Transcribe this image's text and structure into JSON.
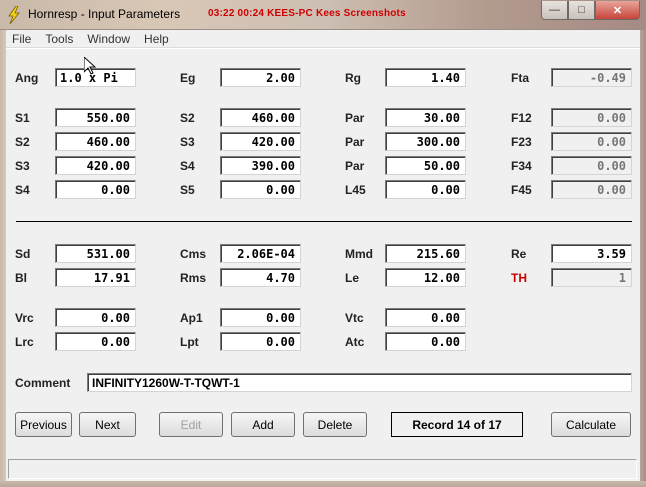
{
  "window": {
    "title": "Hornresp - Input Parameters",
    "recording_overlay": "03:22 00:24 KEES-PC Kees Screenshots",
    "minimize_glyph": "—",
    "maximize_glyph": "□",
    "close_glyph": "✕"
  },
  "menu": [
    "File",
    "Tools",
    "Window",
    "Help"
  ],
  "params": {
    "ang": {
      "label": "Ang",
      "value": "1.0 x Pi"
    },
    "eg": {
      "label": "Eg",
      "value": "2.00"
    },
    "rg": {
      "label": "Rg",
      "value": "1.40"
    },
    "fta": {
      "label": "Fta",
      "value": "-0.49"
    },
    "s1": {
      "label": "S1",
      "value": "550.00"
    },
    "s2a": {
      "label": "S2",
      "value": "460.00"
    },
    "par1": {
      "label": "Par",
      "value": "30.00"
    },
    "f12": {
      "label": "F12",
      "value": "0.00"
    },
    "s2b": {
      "label": "S2",
      "value": "460.00"
    },
    "s3a": {
      "label": "S3",
      "value": "420.00"
    },
    "par2": {
      "label": "Par",
      "value": "300.00"
    },
    "f23": {
      "label": "F23",
      "value": "0.00"
    },
    "s3b": {
      "label": "S3",
      "value": "420.00"
    },
    "s4a": {
      "label": "S4",
      "value": "390.00"
    },
    "par3": {
      "label": "Par",
      "value": "50.00"
    },
    "f34": {
      "label": "F34",
      "value": "0.00"
    },
    "s4b": {
      "label": "S4",
      "value": "0.00"
    },
    "s5": {
      "label": "S5",
      "value": "0.00"
    },
    "l45": {
      "label": "L45",
      "value": "0.00"
    },
    "f45": {
      "label": "F45",
      "value": "0.00"
    },
    "sd": {
      "label": "Sd",
      "value": "531.00"
    },
    "cms": {
      "label": "Cms",
      "value": "2.06E-04"
    },
    "mmd": {
      "label": "Mmd",
      "value": "215.60"
    },
    "re": {
      "label": "Re",
      "value": "3.59"
    },
    "bl": {
      "label": "Bl",
      "value": "17.91"
    },
    "rms": {
      "label": "Rms",
      "value": "4.70"
    },
    "le": {
      "label": "Le",
      "value": "12.00"
    },
    "th": {
      "label": "TH",
      "value": "1"
    },
    "vrc": {
      "label": "Vrc",
      "value": "0.00"
    },
    "ap1": {
      "label": "Ap1",
      "value": "0.00"
    },
    "vtc": {
      "label": "Vtc",
      "value": "0.00"
    },
    "lrc": {
      "label": "Lrc",
      "value": "0.00"
    },
    "lpt": {
      "label": "Lpt",
      "value": "0.00"
    },
    "atc": {
      "label": "Atc",
      "value": "0.00"
    }
  },
  "comment": {
    "label": "Comment",
    "value": "INFINITY1260W-T-TQWT-1"
  },
  "buttons": {
    "previous": "Previous",
    "next": "Next",
    "edit": "Edit",
    "add": "Add",
    "delete": "Delete",
    "calculate": "Calculate"
  },
  "record": "Record 14 of 17",
  "colors": {
    "accent_red": "#cc0000",
    "face": "#f0f0f0"
  }
}
